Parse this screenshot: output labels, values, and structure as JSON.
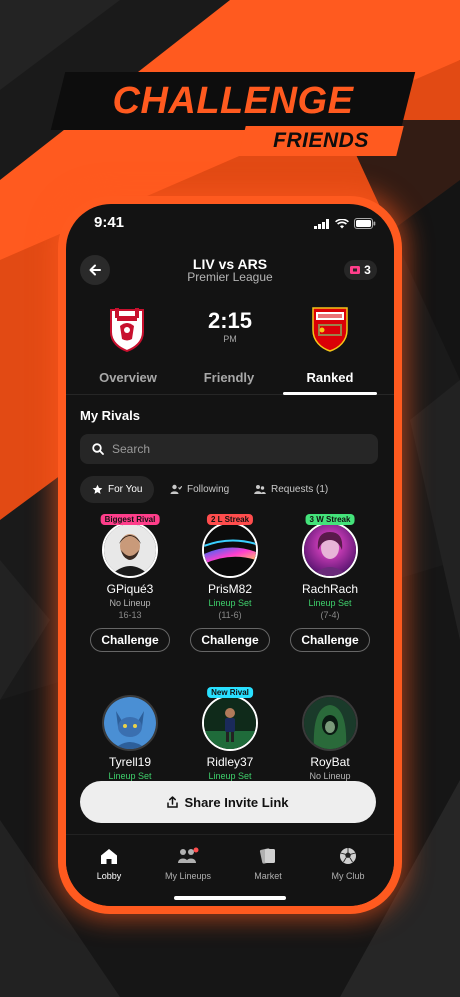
{
  "headline": {
    "title": "CHALLENGE",
    "subtitle": "FRIENDS"
  },
  "colors": {
    "accent": "#ff5a1f",
    "green": "#3fd06c",
    "pink": "#ff3e8b",
    "red": "#ff4d4d",
    "lime": "#44e37a",
    "cyan": "#29e0ff"
  },
  "status_bar": {
    "time": "9:41",
    "icons": [
      "signal-icon",
      "wifi-icon",
      "battery-icon"
    ]
  },
  "match": {
    "title": "LIV vs ARS",
    "league": "Premier League",
    "kickoff_time": "2:15",
    "kickoff_ampm": "PM",
    "coins": "3"
  },
  "tabs": [
    {
      "label": "Overview"
    },
    {
      "label": "Friendly"
    },
    {
      "label": "Ranked",
      "active": true
    }
  ],
  "rivals_section": {
    "title": "My Rivals"
  },
  "search": {
    "placeholder": "Search"
  },
  "filters": [
    {
      "label": "For You",
      "active": true,
      "icon": "star-icon"
    },
    {
      "label": "Following",
      "icon": "user-check-icon"
    },
    {
      "label": "Requests (1)",
      "icon": "users-icon"
    }
  ],
  "rivals": [
    {
      "tag": "Biggest Rival",
      "name": "GPiqué3",
      "status": "No Lineup",
      "record": "16-13",
      "challenge_label": "Challenge"
    },
    {
      "tag": "2 L Streak",
      "name": "PrisM82",
      "status": "Lineup Set",
      "record": "(11-6)",
      "challenge_label": "Challenge"
    },
    {
      "tag": "3 W Streak",
      "name": "RachRach",
      "status": "Lineup Set",
      "record": "(7-4)",
      "challenge_label": "Challenge"
    },
    {
      "tag": "",
      "name": "Tyrell19",
      "status": "Lineup Set"
    },
    {
      "tag": "New Rival",
      "name": "Ridley37",
      "status": "Lineup Set"
    },
    {
      "tag": "",
      "name": "RoyBat",
      "status": "No Lineup"
    }
  ],
  "share": {
    "label": "Share Invite Link"
  },
  "bottom_nav": [
    {
      "label": "Lobby",
      "active": true
    },
    {
      "label": "My Lineups"
    },
    {
      "label": "Market"
    },
    {
      "label": "My Club"
    }
  ]
}
